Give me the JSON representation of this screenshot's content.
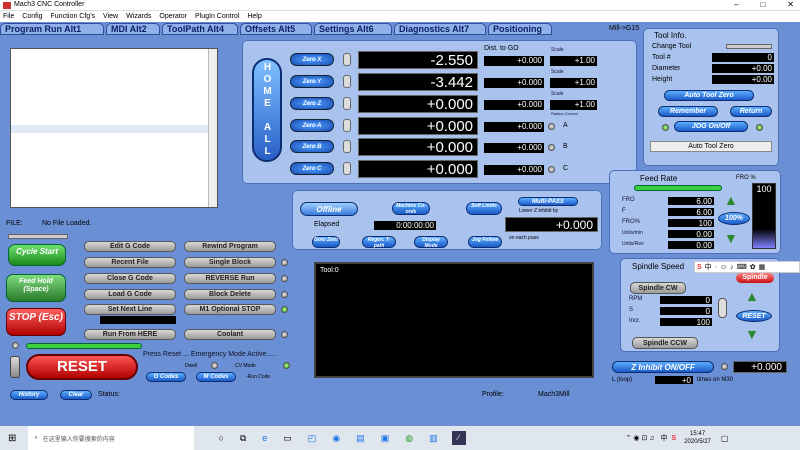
{
  "window": {
    "title": "Mach3 CNC Controller",
    "controls": [
      "–",
      "□",
      "✕"
    ]
  },
  "menu": [
    "File",
    "Config",
    "Function Cfg's",
    "View",
    "Wizards",
    "Operator",
    "PlugIn Control",
    "Help"
  ],
  "tabs": [
    "Program Run Alt1",
    "MDI Alt2",
    "ToolPath Alt4",
    "Offsets Alt5",
    "Settings Alt6",
    "Diagnostics Alt7",
    "Positioning"
  ],
  "mill_label": "Mill->G15",
  "home_all": "HOME ALL",
  "axes": [
    {
      "zero": "Zero X",
      "value": "-2.550",
      "dist": "+0.000",
      "scale": "+1.00"
    },
    {
      "zero": "Zero Y",
      "value": "-3.442",
      "dist": "+0.000",
      "scale": "+1.00"
    },
    {
      "zero": "Zero Z",
      "value": "+0.000",
      "dist": "+0.000",
      "scale": "+1.00"
    },
    {
      "zero": "Zero A",
      "value": "+0.000",
      "dist": "+0.000",
      "axis": "A"
    },
    {
      "zero": "Zero B",
      "value": "+0.000",
      "dist": "+0.000",
      "axis": "B"
    },
    {
      "zero": "Zero C",
      "value": "+0.000",
      "dist": "+0.000",
      "axis": "C"
    }
  ],
  "dist_to_go": "Dist. to GO",
  "scale_label": "Scale",
  "radius_correct": "Radius Correct",
  "tool_info": {
    "title": "Tool Info.",
    "change_tool": "Change Tool",
    "tool_label": "Tool #",
    "tool": "0",
    "diameter_label": "Diameter",
    "diameter": "+0.00",
    "height_label": "Height",
    "height": "+0.00",
    "auto_tool_zero": "Auto Tool Zero",
    "remember": "Remember",
    "return": "Return",
    "jog": "JOG On/Off",
    "auto_tool_zero2": "Auto Tool Zero"
  },
  "mid": {
    "offline": "Offline",
    "machine_coords": "Machine Co-ords",
    "soft_limits": "Soft Limits",
    "multi_pass": "Multi-PASS",
    "lower_z": "Lower Z inhibit by",
    "lower_z_val": "+0.000",
    "elapsed_label": "Elapsed",
    "elapsed": "0:00:00:00",
    "goto_zero": "Goto Zero",
    "regen": "Regen. T-path",
    "display_mode": "Display Mode",
    "jog_follow": "Jog Follow",
    "on_each_pass": "on each pass"
  },
  "feed": {
    "title": "Feed Rate",
    "fro_pct": "FRO %",
    "fro_val": "100",
    "fro_label": "FRO",
    "fro": "6.00",
    "f_label": "F",
    "f": "6.00",
    "frop_label": "FRO%",
    "frop": "100",
    "units_min_label": "Units/min",
    "units_min": "0.00",
    "units_rev_label": "Units/Rev",
    "units_rev": "0.00",
    "reset": "100%"
  },
  "spindle": {
    "title": "Spindle Speed",
    "cw": "Spindle CW",
    "ccw": "Spindle CCW",
    "rpm_label": "RPM",
    "rpm": "0",
    "s_label": "S",
    "s": "0",
    "incr_label": "Incr.",
    "incr": "100",
    "reset": "RESET",
    "spindle": "Spindle"
  },
  "file": {
    "label": "FILE:",
    "name": "No File Loaded."
  },
  "buttons": {
    "cycle": "Cycle Start",
    "feedhold": "Feed Hold (Space)",
    "stop": "STOP (Esc)",
    "reset": "RESET",
    "edit": "Edit G Code",
    "recent": "Recent File",
    "close": "Close G Code",
    "load": "Load G Code",
    "next": "Set Next Line",
    "run_from": "Run From HERE",
    "rewind": "Rewind Program",
    "single": "Single Block",
    "reverse": "REVERSE Run",
    "block_delete": "Block Delete",
    "m1": "M1 Optional STOP",
    "coolant": "Coolant",
    "history": "History",
    "clear": "Clear",
    "gcodes": "G Codes",
    "mcodes": "M Codes"
  },
  "tool_display": "Tool:0",
  "status": {
    "press_reset": "Press Reset ... Emergency Mode Active.....",
    "dwell": "Dwell",
    "cv_mode": "CV Mode",
    "run_code": "-Run Code",
    "status_label": "Status:",
    "profile_label": "Profile:",
    "profile": "Mach3Mill"
  },
  "z_inhibit": {
    "label": "Z Inhibit ON/OFF",
    "value": "+0.000",
    "l_loop": "L (loop)",
    "l_val": "+0",
    "times": "times on M30"
  },
  "taskbar": {
    "search": "在这里输入你要搜索的内容",
    "time": "15:47",
    "date": "2020/5/27",
    "lang": "中",
    "ime": "S"
  }
}
